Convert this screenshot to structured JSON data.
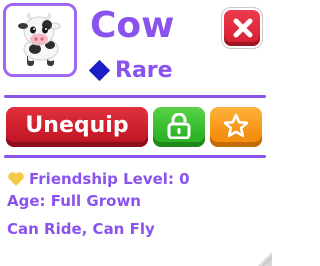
{
  "pet": {
    "name": "Cow",
    "rarity": "Rare",
    "image_icon": "cow-pet-icon"
  },
  "actions": {
    "unequip_label": "Unequip",
    "lock_icon": "unlocked-padlock-icon",
    "favorite_icon": "star-outline-icon",
    "close_icon": "close-x-icon"
  },
  "info": {
    "friendship": "Friendship Level: 0",
    "age": "Age: Full Grown",
    "abilities": "Can Ride, Can Fly"
  },
  "colors": {
    "accent": "#8b53ee",
    "rarity_diamond": "#1d1fc4",
    "unequip": "#cc1d2c",
    "lock": "#2fb52a",
    "favorite": "#f48f12",
    "close": "#d41d31",
    "heart": "#f7c948"
  }
}
